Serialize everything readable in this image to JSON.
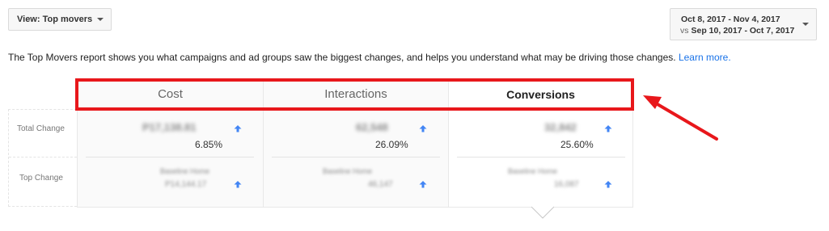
{
  "view_button": {
    "label": "View: Top movers"
  },
  "date_range": {
    "primary": "Oct 8, 2017 - Nov 4, 2017",
    "vs_label": "vs",
    "compare": "Sep 10, 2017 - Oct 7, 2017"
  },
  "description": {
    "text": "The Top Movers report shows you what campaigns and ad groups saw the biggest changes, and helps you understand what may be driving those changes.",
    "link": "Learn more."
  },
  "row_labels": {
    "total_change": "Total Change",
    "top_change": "Top Change"
  },
  "columns": [
    {
      "label": "Cost",
      "total_value": "P17,138.81",
      "total_pct": "6.85%",
      "top_name": "Baseline Home",
      "top_value": "P14,144.17"
    },
    {
      "label": "Interactions",
      "total_value": "62,548",
      "total_pct": "26.09%",
      "top_name": "Baseline Home",
      "top_value": "46,147"
    },
    {
      "label": "Conversions",
      "total_value": "32,842",
      "total_pct": "25.60%",
      "top_name": "Baseline Home",
      "top_value": "16,087",
      "active": true
    }
  ],
  "colors": {
    "accent_red": "#e8171b",
    "arrow_blue": "#4285f4",
    "link_blue": "#1a73e8"
  },
  "icons": {
    "up_arrow": "arrow-up-icon",
    "dropdown": "caret-down-icon"
  }
}
